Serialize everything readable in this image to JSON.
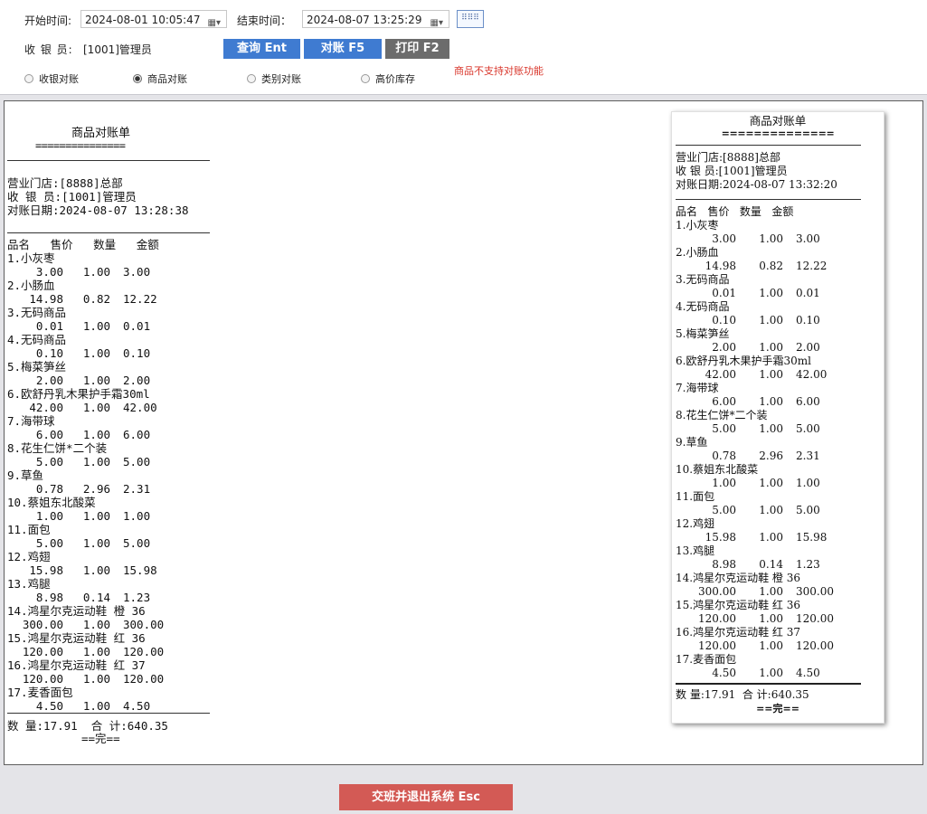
{
  "query": {
    "start_label": "开始时间:",
    "start_value": "2024-08-01 10:05:47",
    "end_label": "结束时间：",
    "end_value": "2024-08-07 13:25:29",
    "cashier_label": "收 银 员:",
    "cashier_value": "[1001]管理员"
  },
  "buttons": {
    "query": "查询 Ent",
    "reconcile": "对账 F5",
    "print": "打印 F2",
    "exit": "交班并退出系统 Esc"
  },
  "modes": [
    {
      "label": "收银对账",
      "selected": false
    },
    {
      "label": "商品对账",
      "selected": true
    },
    {
      "label": "类别对账",
      "selected": false
    },
    {
      "label": "高价库存",
      "selected": false
    }
  ],
  "warning": "商品不支持对账功能",
  "report": {
    "title": "商品对账单",
    "underline": "===============",
    "store": "营业门店:[8888]总部",
    "cashier": "收 银 员:[1001]管理员",
    "date": "对账日期:2024-08-07 13:28:38",
    "header": "品名   售价   数量   金额",
    "items": [
      {
        "name": "1.小灰枣",
        "price": "3.00",
        "qty": "1.00",
        "amount": "3.00"
      },
      {
        "name": "2.小肠血",
        "price": "14.98",
        "qty": "0.82",
        "amount": "12.22"
      },
      {
        "name": "3.无码商品",
        "price": "0.01",
        "qty": "1.00",
        "amount": "0.01"
      },
      {
        "name": "4.无码商品",
        "price": "0.10",
        "qty": "1.00",
        "amount": "0.10"
      },
      {
        "name": "5.梅菜笋丝",
        "price": "2.00",
        "qty": "1.00",
        "amount": "2.00"
      },
      {
        "name": "6.欧舒丹乳木果护手霜30ml",
        "price": "42.00",
        "qty": "1.00",
        "amount": "42.00"
      },
      {
        "name": "7.海带球",
        "price": "6.00",
        "qty": "1.00",
        "amount": "6.00"
      },
      {
        "name": "8.花生仁饼*二个装",
        "price": "5.00",
        "qty": "1.00",
        "amount": "5.00"
      },
      {
        "name": "9.草鱼",
        "price": "0.78",
        "qty": "2.96",
        "amount": "2.31"
      },
      {
        "name": "10.蔡姐东北酸菜",
        "price": "1.00",
        "qty": "1.00",
        "amount": "1.00"
      },
      {
        "name": "11.面包",
        "price": "5.00",
        "qty": "1.00",
        "amount": "5.00"
      },
      {
        "name": "12.鸡翅",
        "price": "15.98",
        "qty": "1.00",
        "amount": "15.98"
      },
      {
        "name": "13.鸡腿",
        "price": "8.98",
        "qty": "0.14",
        "amount": "1.23"
      },
      {
        "name": "14.鸿星尔克运动鞋 橙 36",
        "price": "300.00",
        "qty": "1.00",
        "amount": "300.00"
      },
      {
        "name": "15.鸿星尔克运动鞋 红 36",
        "price": "120.00",
        "qty": "1.00",
        "amount": "120.00"
      },
      {
        "name": "16.鸿星尔克运动鞋 红 37",
        "price": "120.00",
        "qty": "1.00",
        "amount": "120.00"
      },
      {
        "name": "17.麦香面包",
        "price": "4.50",
        "qty": "1.00",
        "amount": "4.50"
      }
    ],
    "total": "数 量:17.91  合 计:640.35",
    "end": "==完=="
  },
  "preview": {
    "title": "商品对账单",
    "underline": "==============",
    "store": "营业门店:[8888]总部",
    "cashier": "收 银 员:[1001]管理员",
    "date": "对账日期:2024-08-07 13:32:20",
    "header": "品名   售价   数量   金额",
    "items": [
      {
        "name": "1.小灰枣",
        "price": "3.00",
        "qty": "1.00",
        "amount": "3.00"
      },
      {
        "name": "2.小肠血",
        "price": "14.98",
        "qty": "0.82",
        "amount": "12.22"
      },
      {
        "name": "3.无码商品",
        "price": "0.01",
        "qty": "1.00",
        "amount": "0.01"
      },
      {
        "name": "4.无码商品",
        "price": "0.10",
        "qty": "1.00",
        "amount": "0.10"
      },
      {
        "name": "5.梅菜笋丝",
        "price": "2.00",
        "qty": "1.00",
        "amount": "2.00"
      },
      {
        "name": "6.欧舒丹乳木果护手霜30ml",
        "price": "42.00",
        "qty": "1.00",
        "amount": "42.00"
      },
      {
        "name": "7.海带球",
        "price": "6.00",
        "qty": "1.00",
        "amount": "6.00"
      },
      {
        "name": "8.花生仁饼*二个装",
        "price": "5.00",
        "qty": "1.00",
        "amount": "5.00"
      },
      {
        "name": "9.草鱼",
        "price": "0.78",
        "qty": "2.96",
        "amount": "2.31"
      },
      {
        "name": "10.蔡姐东北酸菜",
        "price": "1.00",
        "qty": "1.00",
        "amount": "1.00"
      },
      {
        "name": "11.面包",
        "price": "5.00",
        "qty": "1.00",
        "amount": "5.00"
      },
      {
        "name": "12.鸡翅",
        "price": "15.98",
        "qty": "1.00",
        "amount": "15.98"
      },
      {
        "name": "13.鸡腿",
        "price": "8.98",
        "qty": "0.14",
        "amount": "1.23"
      },
      {
        "name": "14.鸿星尔克运动鞋 橙 36",
        "price": "300.00",
        "qty": "1.00",
        "amount": "300.00"
      },
      {
        "name": "15.鸿星尔克运动鞋 红 36",
        "price": "120.00",
        "qty": "1.00",
        "amount": "120.00"
      },
      {
        "name": "16.鸿星尔克运动鞋 红 37",
        "price": "120.00",
        "qty": "1.00",
        "amount": "120.00"
      },
      {
        "name": "17.麦香面包",
        "price": "4.50",
        "qty": "1.00",
        "amount": "4.50"
      }
    ],
    "total": "数 量:17.91  合 计:640.35",
    "end": "==完=="
  },
  "colors": {
    "accent_blue": "#3f7bd1",
    "print_gray": "#6c6c6c",
    "exit_red": "#d35a55",
    "warning_red": "#d9362b"
  },
  "icons": {
    "date_picker": "calendar-icon",
    "keyboard": "keyboard-icon"
  }
}
